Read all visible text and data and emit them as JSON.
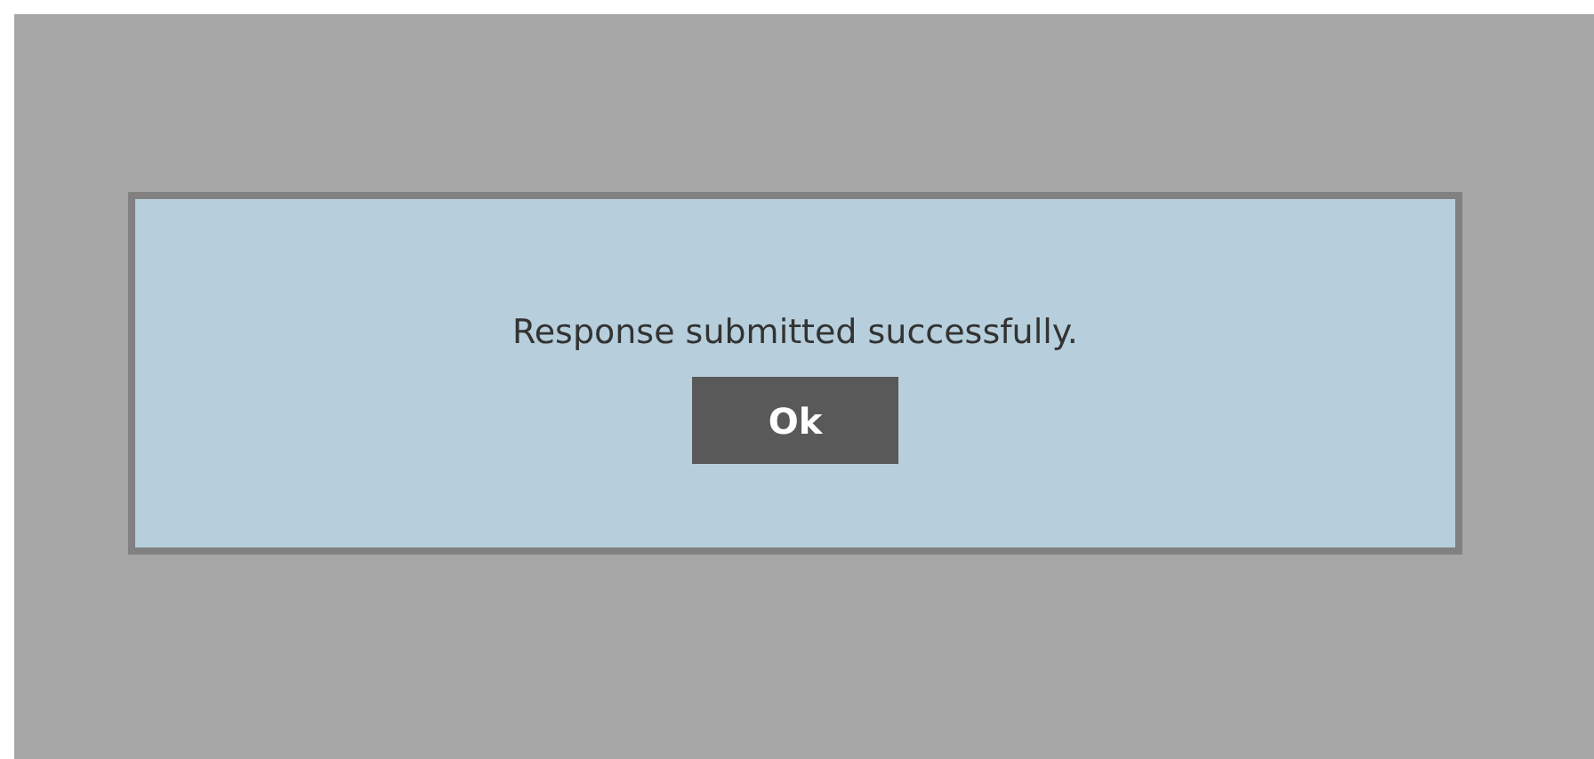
{
  "dialog": {
    "message": "Response submitted successfully.",
    "button": "Ok"
  }
}
